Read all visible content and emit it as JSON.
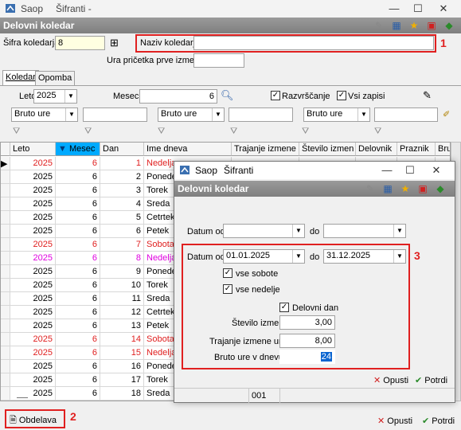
{
  "window": {
    "app": "Saop",
    "title": "Šifranti",
    "title_suffix": "-"
  },
  "header": {
    "title": "Delovni koledar"
  },
  "form": {
    "sifra_label": "Šifra koledarja",
    "sifra_value": "8",
    "naziv_label": "Naziv koledarja",
    "naziv_value": "",
    "ura_label": "Ura pričetka prve izmene",
    "ura_value": ""
  },
  "tabs": [
    "Koledar",
    "Opomba"
  ],
  "filters": {
    "leto_label": "Leto",
    "leto_value": "2025",
    "mesec_label": "Mesec",
    "mesec_value": "6",
    "razvrscanje_label": "Razvrščanje",
    "vsi_zapisi_label": "Vsi zapisi",
    "bruto1": "Bruto ure",
    "bruto2": "Bruto ure",
    "bruto3": "Bruto ure"
  },
  "grid": {
    "columns": [
      "Leto",
      "Mesec",
      "Dan",
      "Ime dneva",
      "Trajanje izmene",
      "Število izmen",
      "Delovnik",
      "Praznik",
      "Bru"
    ],
    "rows": [
      {
        "leto": "2025",
        "mesec": "6",
        "dan": "1",
        "ime": "Nedelja",
        "color": "#e02020"
      },
      {
        "leto": "2025",
        "mesec": "6",
        "dan": "2",
        "ime": "Ponedelj",
        "color": "#000000"
      },
      {
        "leto": "2025",
        "mesec": "6",
        "dan": "3",
        "ime": "Torek",
        "color": "#000000"
      },
      {
        "leto": "2025",
        "mesec": "6",
        "dan": "4",
        "ime": "Sreda",
        "color": "#000000"
      },
      {
        "leto": "2025",
        "mesec": "6",
        "dan": "5",
        "ime": "Cetrtek",
        "color": "#000000"
      },
      {
        "leto": "2025",
        "mesec": "6",
        "dan": "6",
        "ime": "Petek",
        "color": "#000000"
      },
      {
        "leto": "2025",
        "mesec": "6",
        "dan": "7",
        "ime": "Sobota",
        "color": "#e02020"
      },
      {
        "leto": "2025",
        "mesec": "6",
        "dan": "8",
        "ime": "Nedelja",
        "color": "#e000e0"
      },
      {
        "leto": "2025",
        "mesec": "6",
        "dan": "9",
        "ime": "Ponedelj",
        "color": "#000000"
      },
      {
        "leto": "2025",
        "mesec": "6",
        "dan": "10",
        "ime": "Torek",
        "color": "#000000"
      },
      {
        "leto": "2025",
        "mesec": "6",
        "dan": "11",
        "ime": "Sreda",
        "color": "#000000"
      },
      {
        "leto": "2025",
        "mesec": "6",
        "dan": "12",
        "ime": "Cetrtek",
        "color": "#000000"
      },
      {
        "leto": "2025",
        "mesec": "6",
        "dan": "13",
        "ime": "Petek",
        "color": "#000000"
      },
      {
        "leto": "2025",
        "mesec": "6",
        "dan": "14",
        "ime": "Sobota",
        "color": "#e02020"
      },
      {
        "leto": "2025",
        "mesec": "6",
        "dan": "15",
        "ime": "Nedelja",
        "color": "#e02020"
      },
      {
        "leto": "2025",
        "mesec": "6",
        "dan": "16",
        "ime": "Ponedelj",
        "color": "#000000"
      },
      {
        "leto": "2025",
        "mesec": "6",
        "dan": "17",
        "ime": "Torek",
        "color": "#000000"
      },
      {
        "leto": "2025",
        "mesec": "6",
        "dan": "18",
        "ime": "Sreda",
        "color": "#000000"
      },
      {
        "leto": "2025",
        "mesec": "6",
        "dan": "19",
        "ime": "Cetrtek",
        "color": "#000000"
      },
      {
        "leto": "2025",
        "mesec": "6",
        "dan": "20",
        "ime": "Petek",
        "color": "#000000"
      }
    ],
    "status": "001"
  },
  "bottom": {
    "obdelava": "Obdelava",
    "opusti": "Opusti",
    "potrdi": "Potrdi"
  },
  "dialog": {
    "app": "Saop",
    "title": "Šifranti",
    "header": "Delovni koledar",
    "datum_od_label": "Datum od",
    "do_label": "do",
    "datum_od2_label": "Datum od",
    "datum_od2_value": "01.01.2025",
    "do2_label": "do",
    "do2_value": "31.12.2025",
    "vse_sobote": "vse sobote",
    "vse_nedelje": "vse nedelje",
    "delovni_dan": "Delovni dan",
    "st_izmen_label": "Število izmen",
    "st_izmen_value": "3,00",
    "trajanje_label": "Trajanje izmene ure",
    "trajanje_value": "8,00",
    "bruto_label": "Bruto ure v dnevu",
    "bruto_value": "24",
    "opusti": "Opusti",
    "potrdi": "Potrdi"
  },
  "annotations": {
    "n1": "1",
    "n2": "2",
    "n3": "3"
  },
  "colors": {
    "accent_red": "#e02020",
    "header_gray": "#8c8c8c",
    "selected_header": "#00aaff"
  }
}
